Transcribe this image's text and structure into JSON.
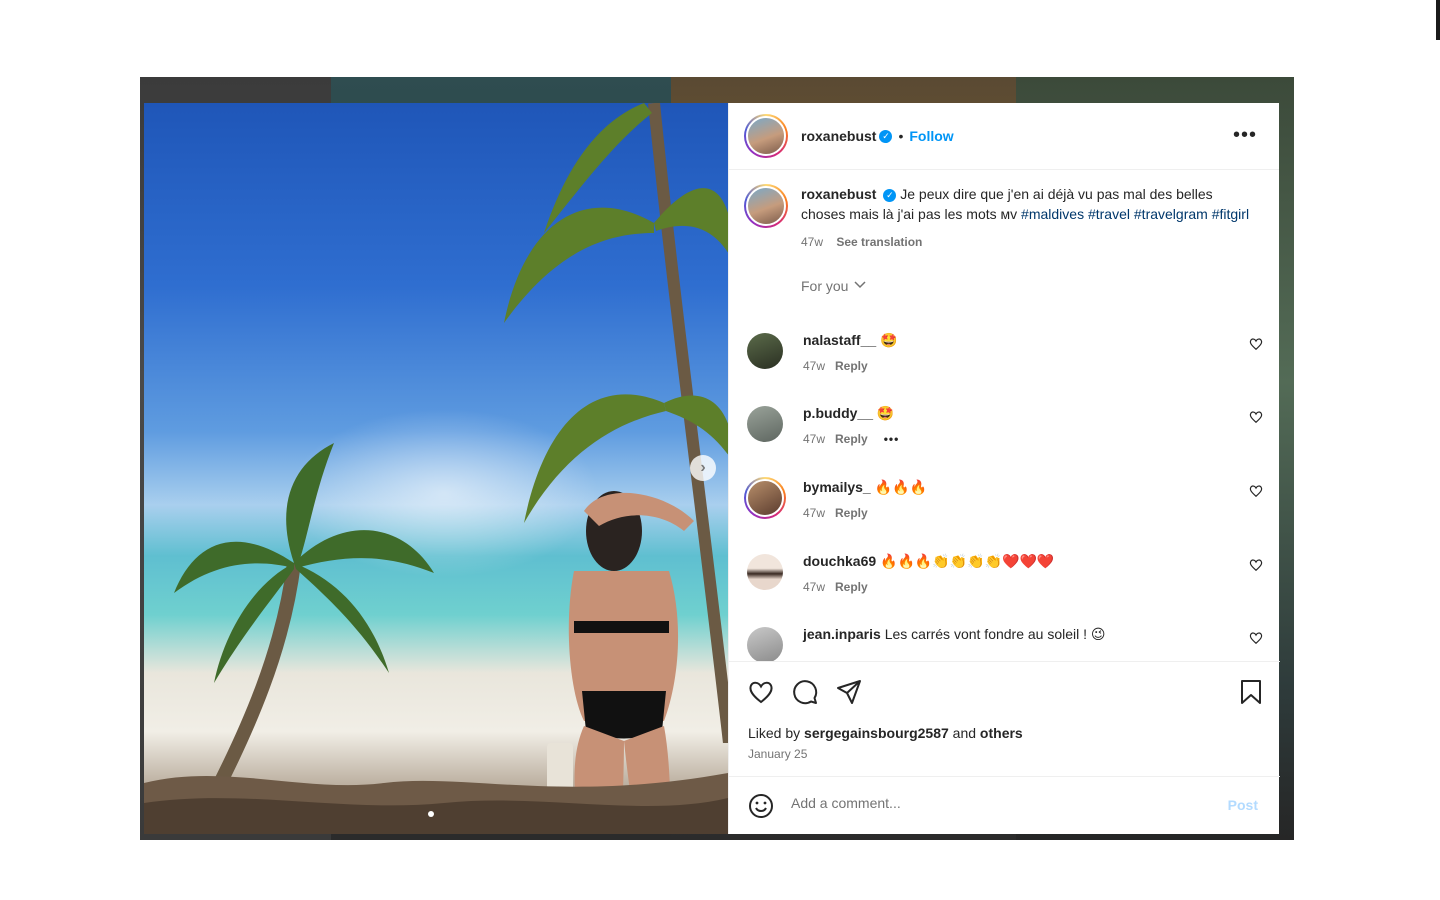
{
  "post": {
    "author": "roxanebust",
    "follow_label": "Follow",
    "sep": "•",
    "more_label": "•••",
    "caption_text": "Je peux dire que j'en ai déjà vu pas mal des belles choses mais là j'ai pas les mots ᴍᴠ",
    "hashtags": [
      "#maldives",
      "#travel",
      "#travelgram",
      "#fitgirl"
    ],
    "caption_age": "47w",
    "see_translation": "See translation",
    "sort_label": "For you",
    "liked_by_prefix": "Liked by",
    "liked_by_user": "sergegainsbourg2587",
    "liked_by_and": "and",
    "liked_by_others": "others",
    "date": "January 25"
  },
  "comments": [
    {
      "user": "nalastaff__",
      "text": "🤩",
      "age": "47w",
      "reply": "Reply"
    },
    {
      "user": "p.buddy__",
      "text": "🤩",
      "age": "47w",
      "reply": "Reply",
      "extra": "•••"
    },
    {
      "user": "bymailys_",
      "text": "🔥🔥🔥",
      "age": "47w",
      "reply": "Reply"
    },
    {
      "user": "douchka69",
      "text": "🔥🔥🔥👏👏👏👏❤️❤️❤️",
      "age": "47w",
      "reply": "Reply"
    },
    {
      "user": "jean.inparis",
      "text": "Les carrés vont fondre au soleil ! 😉",
      "age": "",
      "reply": ""
    }
  ],
  "composer": {
    "placeholder": "Add a comment...",
    "post_label": "Post"
  },
  "colors": {
    "link_blue": "#0095f6",
    "hashtag": "#00376b",
    "muted": "#737373",
    "post_disabled": "#b3dbff"
  },
  "icons": [
    "verified-badge-icon",
    "more-options-icon",
    "chevron-down-icon",
    "heart-icon",
    "comment-icon",
    "share-icon",
    "bookmark-icon",
    "emoji-icon",
    "chevron-right-icon"
  ]
}
